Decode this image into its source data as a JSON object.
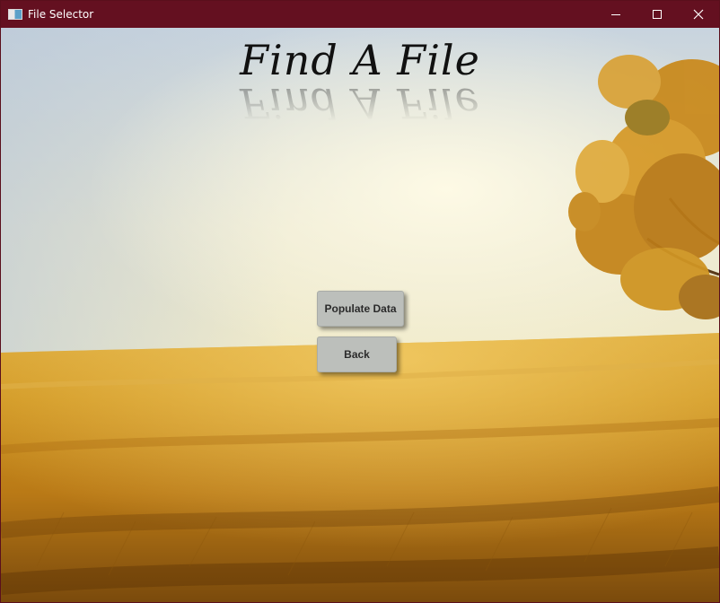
{
  "window": {
    "title": "File Selector",
    "icon": "app-window-icon",
    "controls": {
      "minimize": "minimize-icon",
      "maximize": "maximize-icon",
      "close": "close-icon"
    },
    "titlebar_color": "#641020"
  },
  "main": {
    "heading": "Find A File",
    "background": "wheat-field-with-tree",
    "buttons": {
      "populate_label": "Populate Data",
      "back_label": "Back"
    },
    "button_color": "#bcbfbb"
  }
}
